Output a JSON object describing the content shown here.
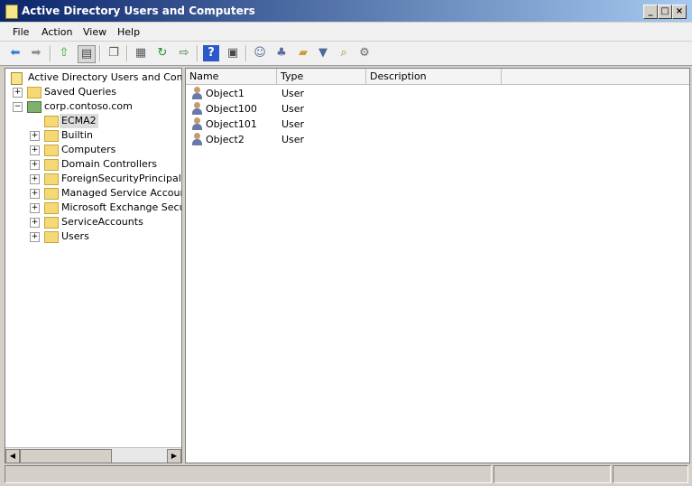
{
  "window": {
    "title": "Active Directory Users and Computers",
    "minimize_glyph": "_",
    "maximize_glyph": "□",
    "close_glyph": "×"
  },
  "menu": [
    "File",
    "Action",
    "View",
    "Help"
  ],
  "toolbar": {
    "icons": [
      "back-icon",
      "forward-icon",
      "up-level-icon",
      "show-hide-console-tree-icon",
      "copy-icon",
      "properties-icon",
      "refresh-icon",
      "export-list-icon",
      "help-icon",
      "show-hide-action-pane-icon",
      "new-user-icon",
      "new-group-icon",
      "new-ou-icon",
      "filter-icon",
      "find-icon",
      "add-to-group-icon"
    ]
  },
  "tree": {
    "root": "Active Directory Users and Comput",
    "items": [
      {
        "label": "Saved Queries",
        "expander": "+"
      },
      {
        "label": "corp.contoso.com",
        "expander": "−"
      },
      {
        "label": "ECMA2",
        "expander": "",
        "selected": true
      },
      {
        "label": "Builtin",
        "expander": "+"
      },
      {
        "label": "Computers",
        "expander": "+"
      },
      {
        "label": "Domain Controllers",
        "expander": "+"
      },
      {
        "label": "ForeignSecurityPrincipals",
        "expander": "+"
      },
      {
        "label": "Managed Service Accounts",
        "expander": "+"
      },
      {
        "label": "Microsoft Exchange Securit",
        "expander": "+"
      },
      {
        "label": "ServiceAccounts",
        "expander": "+"
      },
      {
        "label": "Users",
        "expander": "+"
      }
    ]
  },
  "list": {
    "columns": [
      "Name",
      "Type",
      "Description"
    ],
    "rows": [
      {
        "name": "Object1",
        "type": "User",
        "description": ""
      },
      {
        "name": "Object100",
        "type": "User",
        "description": ""
      },
      {
        "name": "Object101",
        "type": "User",
        "description": ""
      },
      {
        "name": "Object2",
        "type": "User",
        "description": ""
      }
    ]
  },
  "scrollbar": {
    "left_arrow": "◀",
    "right_arrow": "▶"
  }
}
